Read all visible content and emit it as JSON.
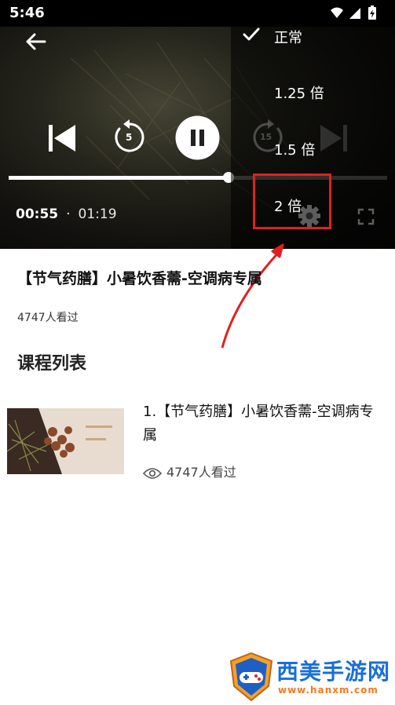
{
  "status_bar": {
    "time": "5:46"
  },
  "player": {
    "current_time": "00:55",
    "separator": "·",
    "duration": "01:19",
    "progress_fraction": 0.58,
    "rewind_seconds": "5",
    "forward_seconds": "15",
    "speed_menu": {
      "options": [
        "正常",
        "1.25 倍",
        "1.5 倍",
        "2 倍"
      ],
      "selected_index": 0
    }
  },
  "course": {
    "title": "【节气药膳】小暑饮香薷-空调病专属",
    "views": "4747人看过"
  },
  "list": {
    "heading": "课程列表",
    "items": [
      {
        "title": "1.【节气药膳】小暑饮香薷-空调病专属",
        "views": "4747人看过"
      }
    ]
  },
  "watermark": {
    "name": "西美手游网",
    "url": "www.hanxm.com"
  },
  "colors": {
    "highlight": "#e02020",
    "arrow": "#e02020",
    "watermark_blue": "#1a6fd6"
  }
}
